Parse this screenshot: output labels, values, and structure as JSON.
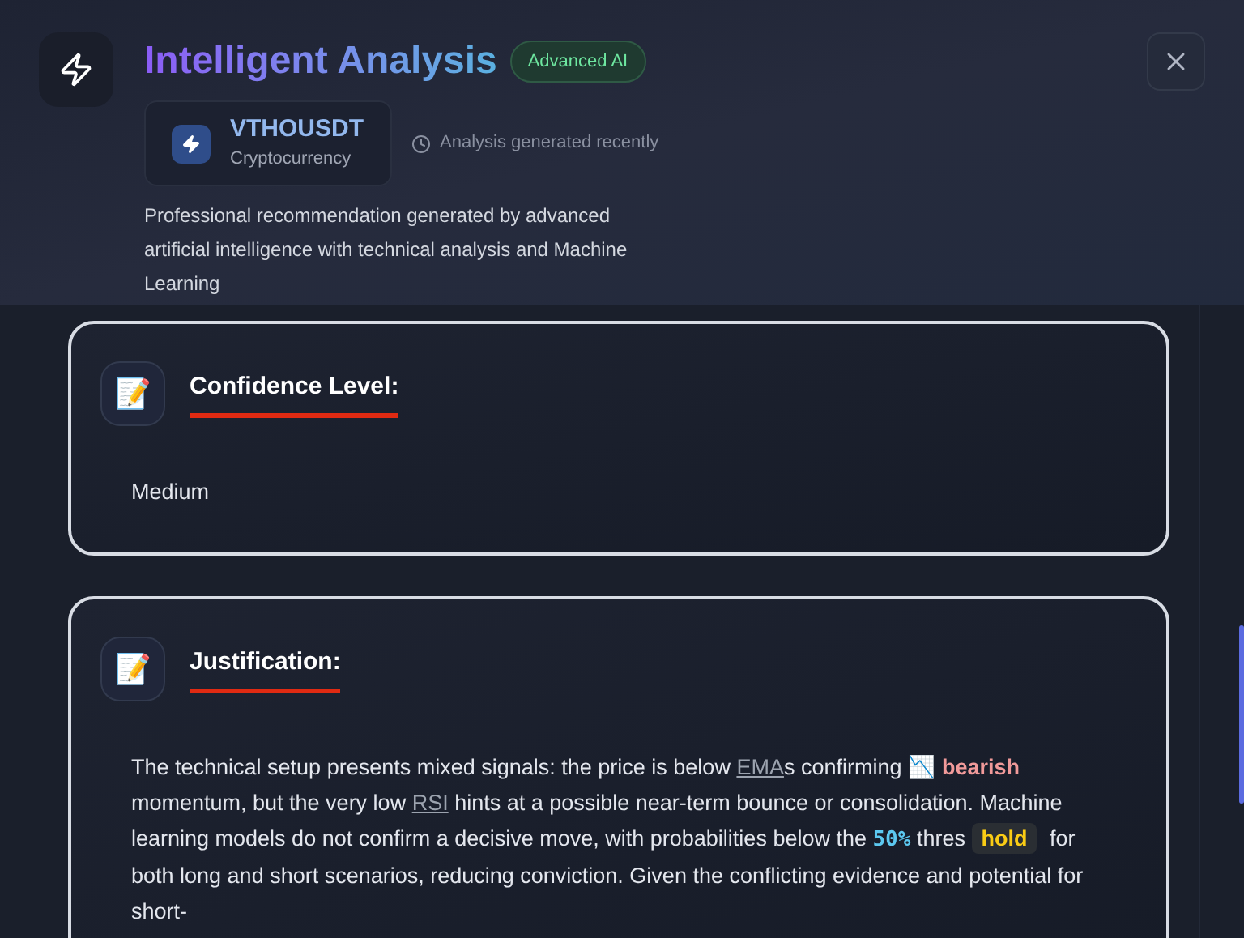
{
  "header": {
    "title": "Intelligent Analysis",
    "badge": "Advanced AI",
    "asset": {
      "symbol": "VTHOUSDT",
      "type": "Cryptocurrency"
    },
    "timestamp": "Analysis generated recently",
    "description": "Professional recommendation generated by advanced artificial intelligence with technical analysis and Machine Learning"
  },
  "sections": [
    {
      "icon": "📝",
      "title": "Confidence Level:",
      "body": [
        {
          "kind": "text",
          "text": "Medium"
        }
      ]
    },
    {
      "icon": "📝",
      "title": "Justification:",
      "body": [
        {
          "kind": "text",
          "text": "The technical setup presents mixed signals: the price is below "
        },
        {
          "kind": "link",
          "text": "EMA"
        },
        {
          "kind": "text",
          "text": "s confirming "
        },
        {
          "kind": "emoji",
          "text": "📉"
        },
        {
          "kind": "negative",
          "text": "bearish"
        },
        {
          "kind": "text",
          "text": " momentum, but the very low "
        },
        {
          "kind": "link",
          "text": "RSI"
        },
        {
          "kind": "text",
          "text": " hints at a possible near-term bounce or consolidation. Machine learning models do not confirm a decisive move, with probabilities below the "
        },
        {
          "kind": "number",
          "text": "50%"
        },
        {
          "kind": "text",
          "text": " thres "
        },
        {
          "kind": "highlight",
          "text": "hold"
        },
        {
          "kind": "text",
          "text": " for both long and short scenarios, reducing conviction. Given the conflicting evidence and potential for short-"
        }
      ]
    }
  ]
}
